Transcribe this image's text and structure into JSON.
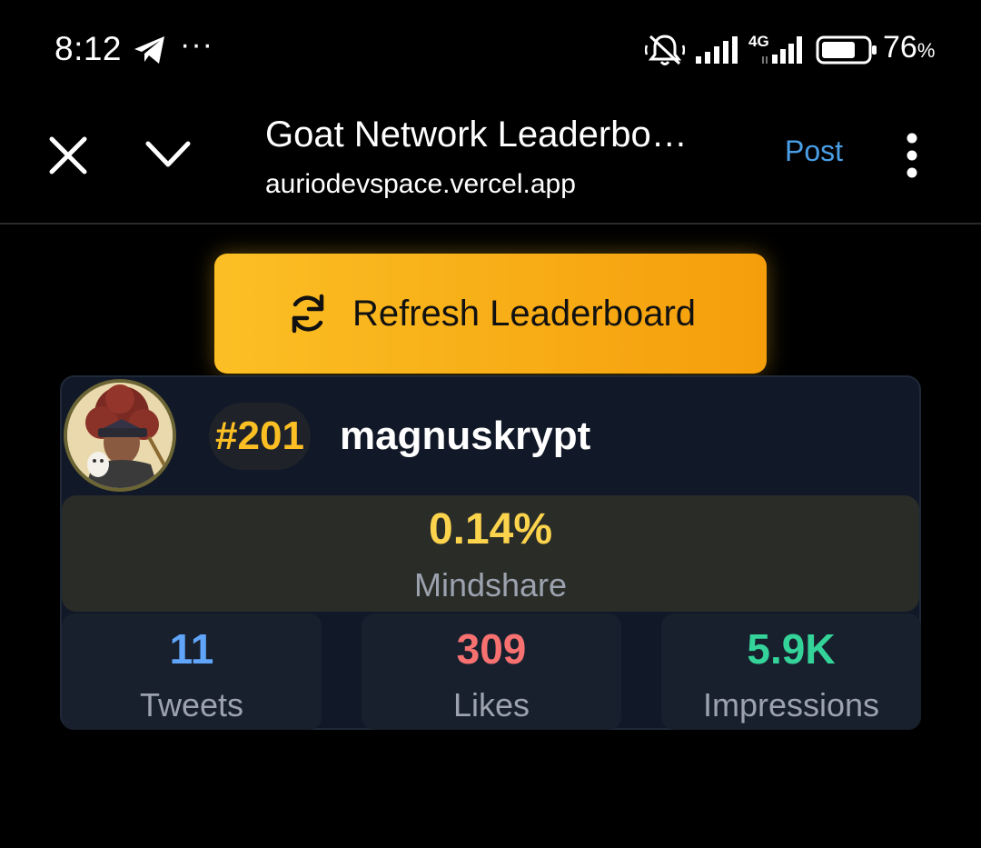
{
  "status_bar": {
    "time": "8:12",
    "dots": "···",
    "network": "4G",
    "battery_percent": "76",
    "battery_unit": "%",
    "battery_level": 0.76
  },
  "browser": {
    "title": "Goat Network Leaderbo…",
    "url": "auriodevspace.vercel.app",
    "post_label": "Post"
  },
  "refresh": {
    "label": "Refresh Leaderboard"
  },
  "entry": {
    "rank": "#201",
    "username": "magnuskrypt",
    "mindshare_value": "0.14%",
    "mindshare_label": "Mindshare",
    "stats": [
      {
        "value": "11",
        "label": "Tweets",
        "color": "#60a5fa"
      },
      {
        "value": "309",
        "label": "Likes",
        "color": "#f87171"
      },
      {
        "value": "5.9K",
        "label": "Impressions",
        "color": "#34d399"
      }
    ]
  },
  "colors": {
    "accent": "#fbbf24",
    "link": "#4a9ee6",
    "card_bg": "#111827"
  }
}
